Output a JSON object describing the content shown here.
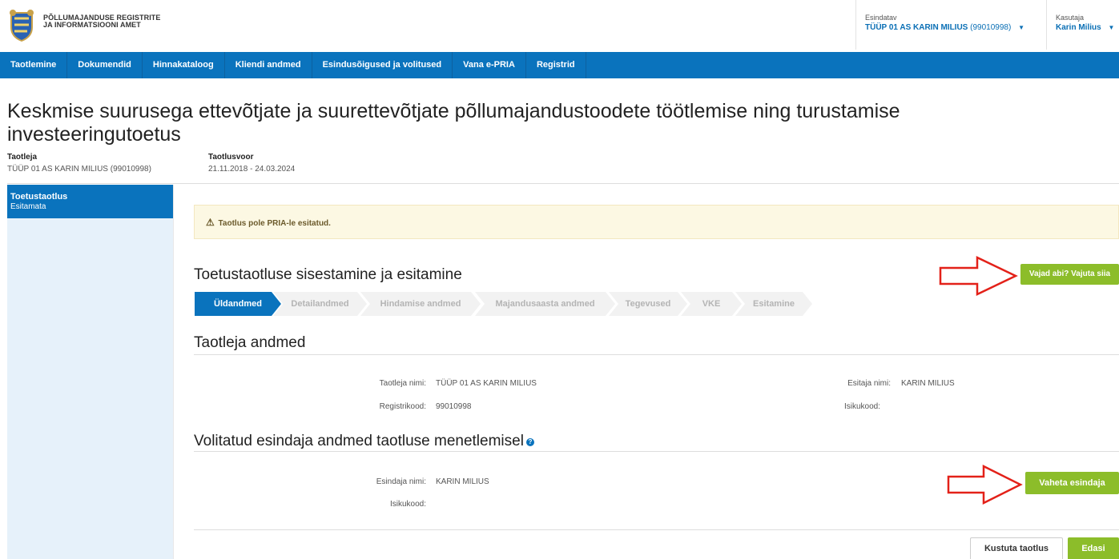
{
  "header": {
    "agency_line1": "Põllumajanduse Registrite",
    "agency_line2": "ja Informatsiooni Amet",
    "esindatav_label": "Esindatav",
    "esindatav_name": "TÜÜP 01 AS KARIN MILIUS",
    "esindatav_code": "(99010998)",
    "kasutaja_label": "Kasutaja",
    "kasutaja_name": "Karin Milius"
  },
  "nav": {
    "items": [
      "Taotlemine",
      "Dokumendid",
      "Hinnakataloog",
      "Kliendi andmed",
      "Esindusõigused ja volitused",
      "Vana e-PRIA",
      "Registrid"
    ]
  },
  "page": {
    "title": "Keskmise suurusega ettevõtjate ja suurettevõtjate põllumajandustoodete töötlemise ning turustamise investeeringutoetus",
    "taotleja_label": "Taotleja",
    "taotleja_value": "TÜÜP 01 AS KARIN MILIUS (99010998)",
    "taotlusvoor_label": "Taotlusvoor",
    "taotlusvoor_value": "21.11.2018 - 24.03.2024"
  },
  "sidebar": {
    "active_title": "Toetustaotlus",
    "active_status": "Esitamata"
  },
  "alert": {
    "text": "Taotlus pole PRIA-le esitatud."
  },
  "section_submit": {
    "heading": "Toetustaotluse sisestamine ja esitamine",
    "help_button": "Vajad abi? Vajuta siia",
    "steps": [
      "Üldandmed",
      "Detailandmed",
      "Hindamise andmed",
      "Majandusaasta andmed",
      "Tegevused",
      "VKE",
      "Esitamine"
    ]
  },
  "section_applicant": {
    "heading": "Taotleja andmed",
    "name_label": "Taotleja nimi:",
    "name_value": "TÜÜP 01 AS KARIN MILIUS",
    "regcode_label": "Registrikood:",
    "regcode_value": "99010998",
    "submitter_label": "Esitaja nimi:",
    "submitter_value": "KARIN MILIUS",
    "idcode_label": "Isikukood:"
  },
  "section_rep": {
    "heading": "Volitatud esindaja andmed taotluse menetlemisel",
    "info_icon": "?",
    "rep_label": "Esindaja nimi:",
    "rep_value": "KARIN MILIUS",
    "idcode_label": "Isikukood:",
    "change_button": "Vaheta esindaja"
  },
  "footer": {
    "delete_button": "Kustuta taotlus",
    "next_button": "Edasi"
  },
  "colors": {
    "brand_blue": "#0a73bd",
    "green": "#8cbd2a",
    "alert_bg": "#fcf8e3",
    "arrow_red": "#e32119"
  }
}
